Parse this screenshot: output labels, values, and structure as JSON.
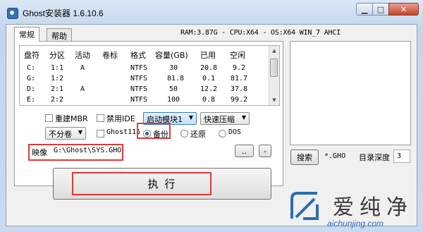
{
  "window": {
    "title": "Ghost安装器 1.6.10.6"
  },
  "tabs": [
    {
      "label": "常规"
    },
    {
      "label": "帮助"
    }
  ],
  "sysinfo": "RAM:3.87G - CPU:X64 - OS:X64 WIN_7 AHCI",
  "partition_table": {
    "headers": [
      "盘符",
      "分区",
      "活动",
      "卷标",
      "格式",
      "容量(GB)",
      "已用",
      "空闲"
    ],
    "rows": [
      [
        "C:",
        "1:1",
        "A",
        "",
        "NTFS",
        "30",
        "20.8",
        "9.2"
      ],
      [
        "G:",
        "1:2",
        "",
        "",
        "NTFS",
        "81.8",
        "0.1",
        "81.7"
      ],
      [
        "D:",
        "2:1",
        "A",
        "",
        "NTFS",
        "50",
        "12.2",
        "37.8"
      ],
      [
        "E:",
        "2:2",
        "",
        "",
        "NTFS",
        "100",
        "0.8",
        "99.2"
      ]
    ]
  },
  "options": {
    "rebuild_mbr": "重建MBR",
    "disable_ide": "禁用IDE",
    "boot_module": "启动模块1",
    "compression": "快速压缩",
    "split": "不分卷",
    "ghost115": "Ghost115",
    "backup": "备份",
    "restore": "还原",
    "dos": "DOS"
  },
  "image": {
    "label": "映像",
    "path": "G:\\Ghost\\SYS.GHO",
    "browse": "..",
    "minus": "-"
  },
  "execute_label": "执  行",
  "search": {
    "button": "搜索",
    "pattern": "*.GHO",
    "depth_label": "目录深度",
    "depth_value": "3"
  },
  "watermark": {
    "text": "爱纯净",
    "url": "aichunjing.com"
  },
  "colors": {
    "highlight_border": "#e03a3a",
    "accent": "#2b6bb5"
  }
}
